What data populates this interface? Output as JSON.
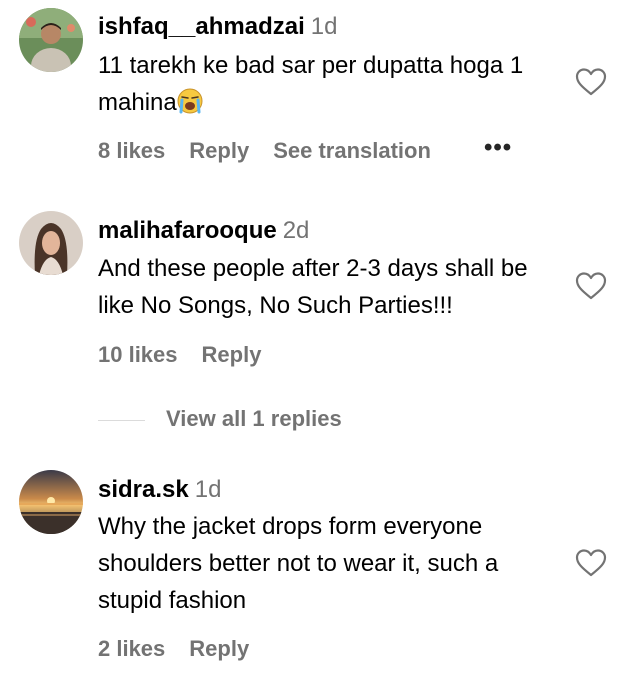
{
  "comments": [
    {
      "username": "ishfaq__ahmadzai",
      "time": "1d",
      "text": "11 tarekh ke bad sar per dupatta hoga 1 mahina",
      "emoji": "loudly-crying-face",
      "likes": "8 likes",
      "reply": "Reply",
      "see_translation": "See translation",
      "more": "•••"
    },
    {
      "username": "malihafarooque",
      "time": "2d",
      "text": "And these people after 2-3 days shall be like No Songs, No Such Parties!!!",
      "likes": "10 likes",
      "reply": "Reply",
      "view_replies": "View all 1 replies"
    },
    {
      "username": "sidra.sk",
      "time": "1d",
      "text": "Why the jacket drops form everyone shoulders better not to wear it, such a stupid fashion",
      "likes": "2 likes",
      "reply": "Reply"
    }
  ],
  "colors": {
    "secondary_text": "#737373",
    "divider": "#dbdbdb"
  }
}
